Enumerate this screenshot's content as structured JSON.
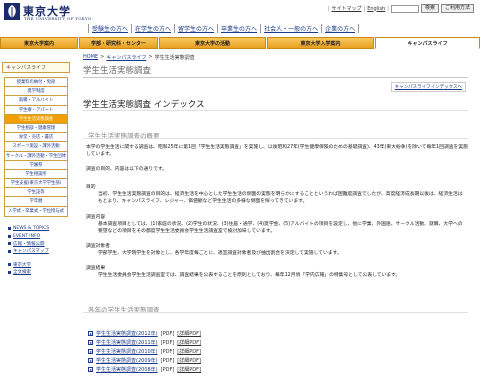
{
  "header": {
    "logo_ja": "東京大学",
    "logo_en": "THE UNIVERSITY OF TOKYO",
    "util": {
      "sitemap": "サイトマップ",
      "english": "English",
      "search_button": "検索",
      "usage_button": "ご利用方法"
    },
    "audience": [
      "受験生の方へ",
      "在学生の方へ",
      "留学生の方へ",
      "卒業生の方へ",
      "社会人・一般の方へ",
      "企業の方へ"
    ],
    "global_nav": [
      {
        "label": "東京大学案内"
      },
      {
        "label": "学部・研究科・センター"
      },
      {
        "label": "東京大学の活動"
      },
      {
        "label": "東京大学入学案内"
      },
      {
        "label": "キャンパスライフ",
        "active": true
      }
    ]
  },
  "sidebar": {
    "title": "キャンパスライフ",
    "menu": [
      {
        "label": "授業料の納付・免除"
      },
      {
        "label": "奨学制度"
      },
      {
        "label": "就職・アルバイト"
      },
      {
        "label": "学生寮・アパート"
      },
      {
        "label": "学生生活実態調査",
        "active": true
      },
      {
        "label": "学生相談・健康管理"
      },
      {
        "label": "食堂・売店・書店"
      },
      {
        "label": "スポーツ施設・課外活動"
      },
      {
        "label": "サークル・課外活動・学生団体"
      },
      {
        "label": "学園祭"
      },
      {
        "label": "学生相談所"
      },
      {
        "label": "学生支援(東京大学学生部)"
      },
      {
        "label": "学生証等"
      },
      {
        "label": "学年暦"
      },
      {
        "label": "入学式・卒業式・学位授与式"
      }
    ],
    "links": [
      "NEWS & TOPICS",
      "EVENT INFO",
      "広報・情報公開",
      "キャンパスマップ"
    ],
    "links2": [
      "東京大学",
      "全文検索"
    ]
  },
  "main": {
    "breadcrumb": [
      "HOME",
      "キャンパスライフ",
      "学生生活実態調査"
    ],
    "page_title": "学生生活実態調査",
    "index_link": "キャンパスライフインデックスへ",
    "heading": "学生生活実態調査 インデックス",
    "section1_title": "学生生活実態調査の概要",
    "intro": "本学の学生生活に関する調査は、昭和25年に第1回「学生生活実態調査」を実施し、以後昭和27年(学生健康保険のための基礎調査)、43年(東大紛争)を除いて毎年1回調査を実施しています。",
    "intro_sub": "調査の目的、内容は以下の通りです。",
    "purpose_label": "目的",
    "purpose_text": "当初、学生生活実態調査の目的は、経済生活を中心とした学生生活の側面の実態を明らかにすることというわば困難度調査でしたが、高度経済成長期以後は、経済生活はもとより、キャンパスライフ、レジャー、価値観など学生生活の多様な側面を探ってきています。",
    "content_label": "調査内容",
    "content_text": "基本調査項目としては、(1)家庭の状況、(2)学生の状況、(3)住居・通学、(4)奨学金、(5)アルバイトの項目を設定し、他に学業、外国語、サークル活動、就職、大学への要望などの項目をその都度学生生活委員会学生生活調査室で検討加味しています。",
    "target_label": "調査対象者",
    "target_text": "学部学生、大学院学生を対象とし、各学年度毎ごとに、適宜調査対象者及び抽出割合を決定して実施しています。",
    "results_label": "調査結果",
    "results_text": "学生生活委員会学生生活調査室では、調査結果を公表することを原則としており、毎年12月頃「学内広報」の特集号として公表しています。",
    "section2_title": "各年の学生生活実態調査",
    "reports": [
      {
        "label": "学生生活実態調査(2012年)",
        "pdf": "[PDF]",
        "detail": "[詳細PDF]"
      },
      {
        "label": "学生生活実態調査(2011年)",
        "pdf": "[PDF]",
        "detail": "[詳細PDF]"
      },
      {
        "label": "学生生活実態調査(2010年)",
        "pdf": "[PDF]",
        "detail": "[詳細PDF]"
      },
      {
        "label": "学生生活実態調査(2009年)",
        "pdf": "[PDF]",
        "detail": "[詳細PDF]"
      },
      {
        "label": "学生生活実態調査(2008年)",
        "pdf": "[PDF]",
        "detail": "[詳細PDF]"
      }
    ]
  },
  "colors": {
    "accent_orange": "#f2a000",
    "nav_border": "#c88a10",
    "link_blue": "#1a3a8a"
  }
}
